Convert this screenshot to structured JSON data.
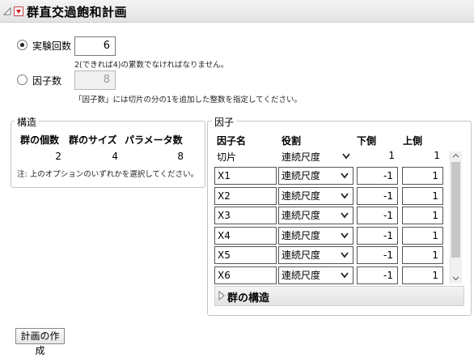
{
  "header": {
    "title": "群直交過飽和計画"
  },
  "options": {
    "runs_label": "実験回数",
    "runs_value": "6",
    "runs_note": "2(できれば4)の累数でなければなりません。",
    "factors_label": "因子数",
    "factors_value": "8",
    "factors_note": "「因子数」には切片の分の1を追加した整数を指定してください。",
    "selected": "runs"
  },
  "structure": {
    "title": "構造",
    "headers": [
      "群の個数",
      "群のサイズ",
      "パラメータ数"
    ],
    "values": [
      "2",
      "4",
      "8"
    ],
    "note": "注: 上のオプションのいずれかを選択してください。"
  },
  "factors": {
    "title": "因子",
    "headers": {
      "name": "因子名",
      "role": "役割",
      "lower": "下側",
      "upper": "上側"
    },
    "intercept": {
      "name": "切片",
      "role": "連続尺度",
      "lower": "1",
      "upper": "1"
    },
    "rows": [
      {
        "name": "X1",
        "role": "連続尺度",
        "lower": "-1",
        "upper": "1"
      },
      {
        "name": "X2",
        "role": "連続尺度",
        "lower": "-1",
        "upper": "1"
      },
      {
        "name": "X3",
        "role": "連続尺度",
        "lower": "-1",
        "upper": "1"
      },
      {
        "name": "X4",
        "role": "連続尺度",
        "lower": "-1",
        "upper": "1"
      },
      {
        "name": "X5",
        "role": "連続尺度",
        "lower": "-1",
        "upper": "1"
      },
      {
        "name": "X6",
        "role": "連続尺度",
        "lower": "-1",
        "upper": "1"
      }
    ],
    "group_structure_label": "群の構造"
  },
  "actions": {
    "make_design": "計画の作成"
  },
  "icons": {
    "collapse": "disclosure-triangle-icon",
    "menu": "red-triangle-menu-icon",
    "dropdown": "chevron-down-icon",
    "scroll_up": "scroll-up-icon",
    "scroll_down": "scroll-down-icon"
  },
  "colors": {
    "menu_red": "#d21d1d"
  }
}
